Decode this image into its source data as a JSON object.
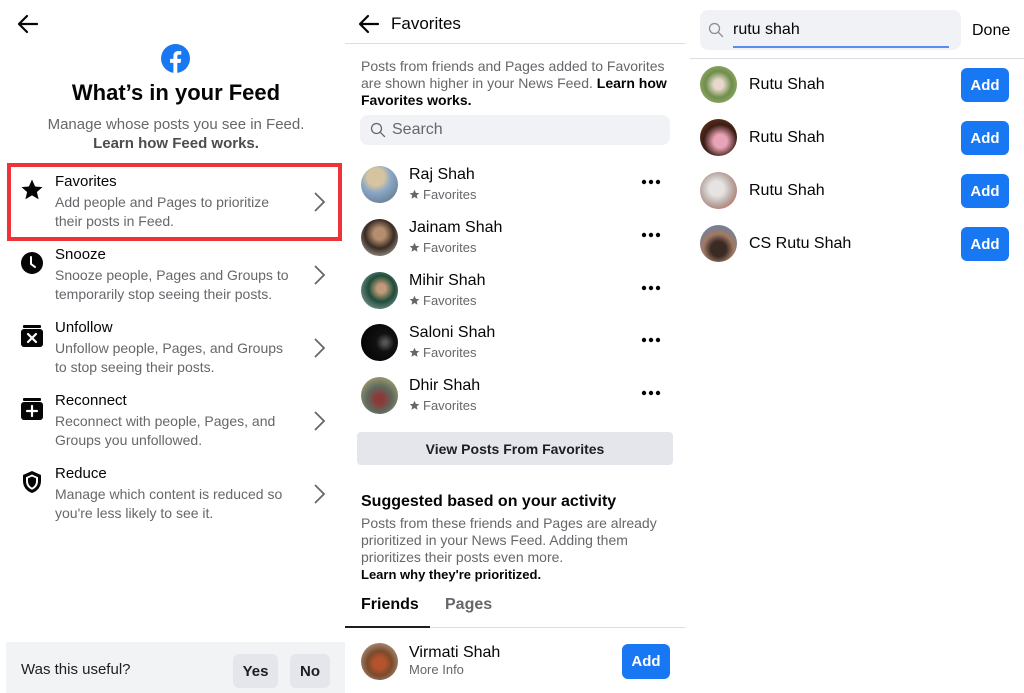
{
  "feed_panel": {
    "title": "What’s in your Feed",
    "subtitle": "Manage whose posts you see in Feed.",
    "learn_link": "Learn how Feed works.",
    "items": [
      {
        "icon": "star-icon",
        "title": "Favorites",
        "desc": "Add people and Pages to prioritize their posts in Feed.",
        "highlighted": true
      },
      {
        "icon": "clock-icon",
        "title": "Snooze",
        "desc": "Snooze people, Pages and Groups to temporarily stop seeing their posts."
      },
      {
        "icon": "unfollow-icon",
        "title": "Unfollow",
        "desc": "Unfollow people, Pages, and Groups to stop seeing their posts."
      },
      {
        "icon": "reconnect-icon",
        "title": "Reconnect",
        "desc": "Reconnect with people, Pages, and Groups you unfollowed."
      },
      {
        "icon": "shield-icon",
        "title": "Reduce",
        "desc": "Manage which content is reduced so you're less likely to see it."
      }
    ],
    "feedback": {
      "question": "Was this useful?",
      "yes_label": "Yes",
      "no_label": "No"
    },
    "highlight_color": "#ee3338",
    "brand_color": "#1877f2"
  },
  "favorites_panel": {
    "title": "Favorites",
    "intro": "Posts from friends and Pages added to Favorites are shown higher in your News Feed.",
    "intro_link": "Learn how Favorites works.",
    "search_placeholder": "Search",
    "favorites": [
      {
        "name": "Raj Shah",
        "sub": "Favorites"
      },
      {
        "name": "Jainam Shah",
        "sub": "Favorites"
      },
      {
        "name": "Mihir Shah",
        "sub": "Favorites"
      },
      {
        "name": "Saloni Shah",
        "sub": "Favorites"
      },
      {
        "name": "Dhir Shah",
        "sub": "Favorites"
      }
    ],
    "view_posts_label": "View Posts From Favorites",
    "suggested": {
      "title": "Suggested based on your activity",
      "desc": "Posts from these friends and Pages are already prioritized in your News Feed. Adding them prioritizes their posts even more.",
      "link": "Learn why they're prioritized.",
      "tabs": [
        {
          "label": "Friends",
          "active": true
        },
        {
          "label": "Pages",
          "active": false
        }
      ],
      "people": [
        {
          "name": "Virmati Shah",
          "sub": "More Info",
          "action": "Add"
        }
      ]
    }
  },
  "search_panel": {
    "query": "rutu shah",
    "done_label": "Done",
    "results": [
      {
        "name": "Rutu Shah",
        "action": "Add"
      },
      {
        "name": "Rutu Shah",
        "action": "Add"
      },
      {
        "name": "Rutu Shah",
        "action": "Add"
      },
      {
        "name": "CS Rutu Shah",
        "action": "Add"
      }
    ]
  }
}
